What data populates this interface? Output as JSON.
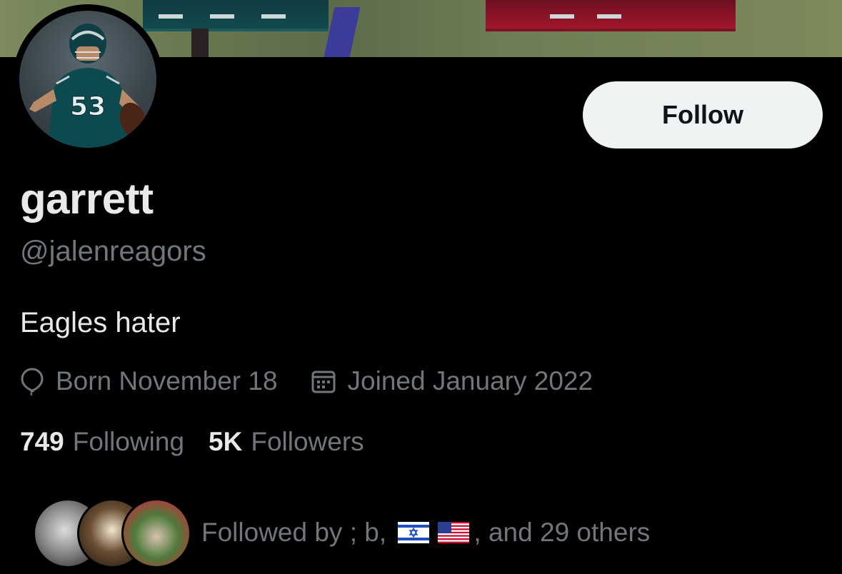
{
  "profile": {
    "display_name": "garrett",
    "handle": "@jalenreagors",
    "bio": "Eagles hater",
    "avatar_jersey_number": "53"
  },
  "actions": {
    "follow_label": "Follow"
  },
  "meta": {
    "birthday": "Born November 18",
    "joined": "Joined January 2022",
    "birthday_icon": "balloon-icon",
    "joined_icon": "calendar-icon"
  },
  "stats": {
    "following_count": "749",
    "following_label": "Following",
    "followers_count": "5K",
    "followers_label": "Followers"
  },
  "followed_by": {
    "prefix": "Followed by",
    "names": "; b,",
    "flags": [
      "israel-flag",
      "usa-flag"
    ],
    "suffix": ", and 29 others"
  },
  "colors": {
    "background": "#000000",
    "primary_text": "#e7e9ea",
    "secondary_text": "#71767b",
    "follow_button_bg": "#eff3f4"
  }
}
